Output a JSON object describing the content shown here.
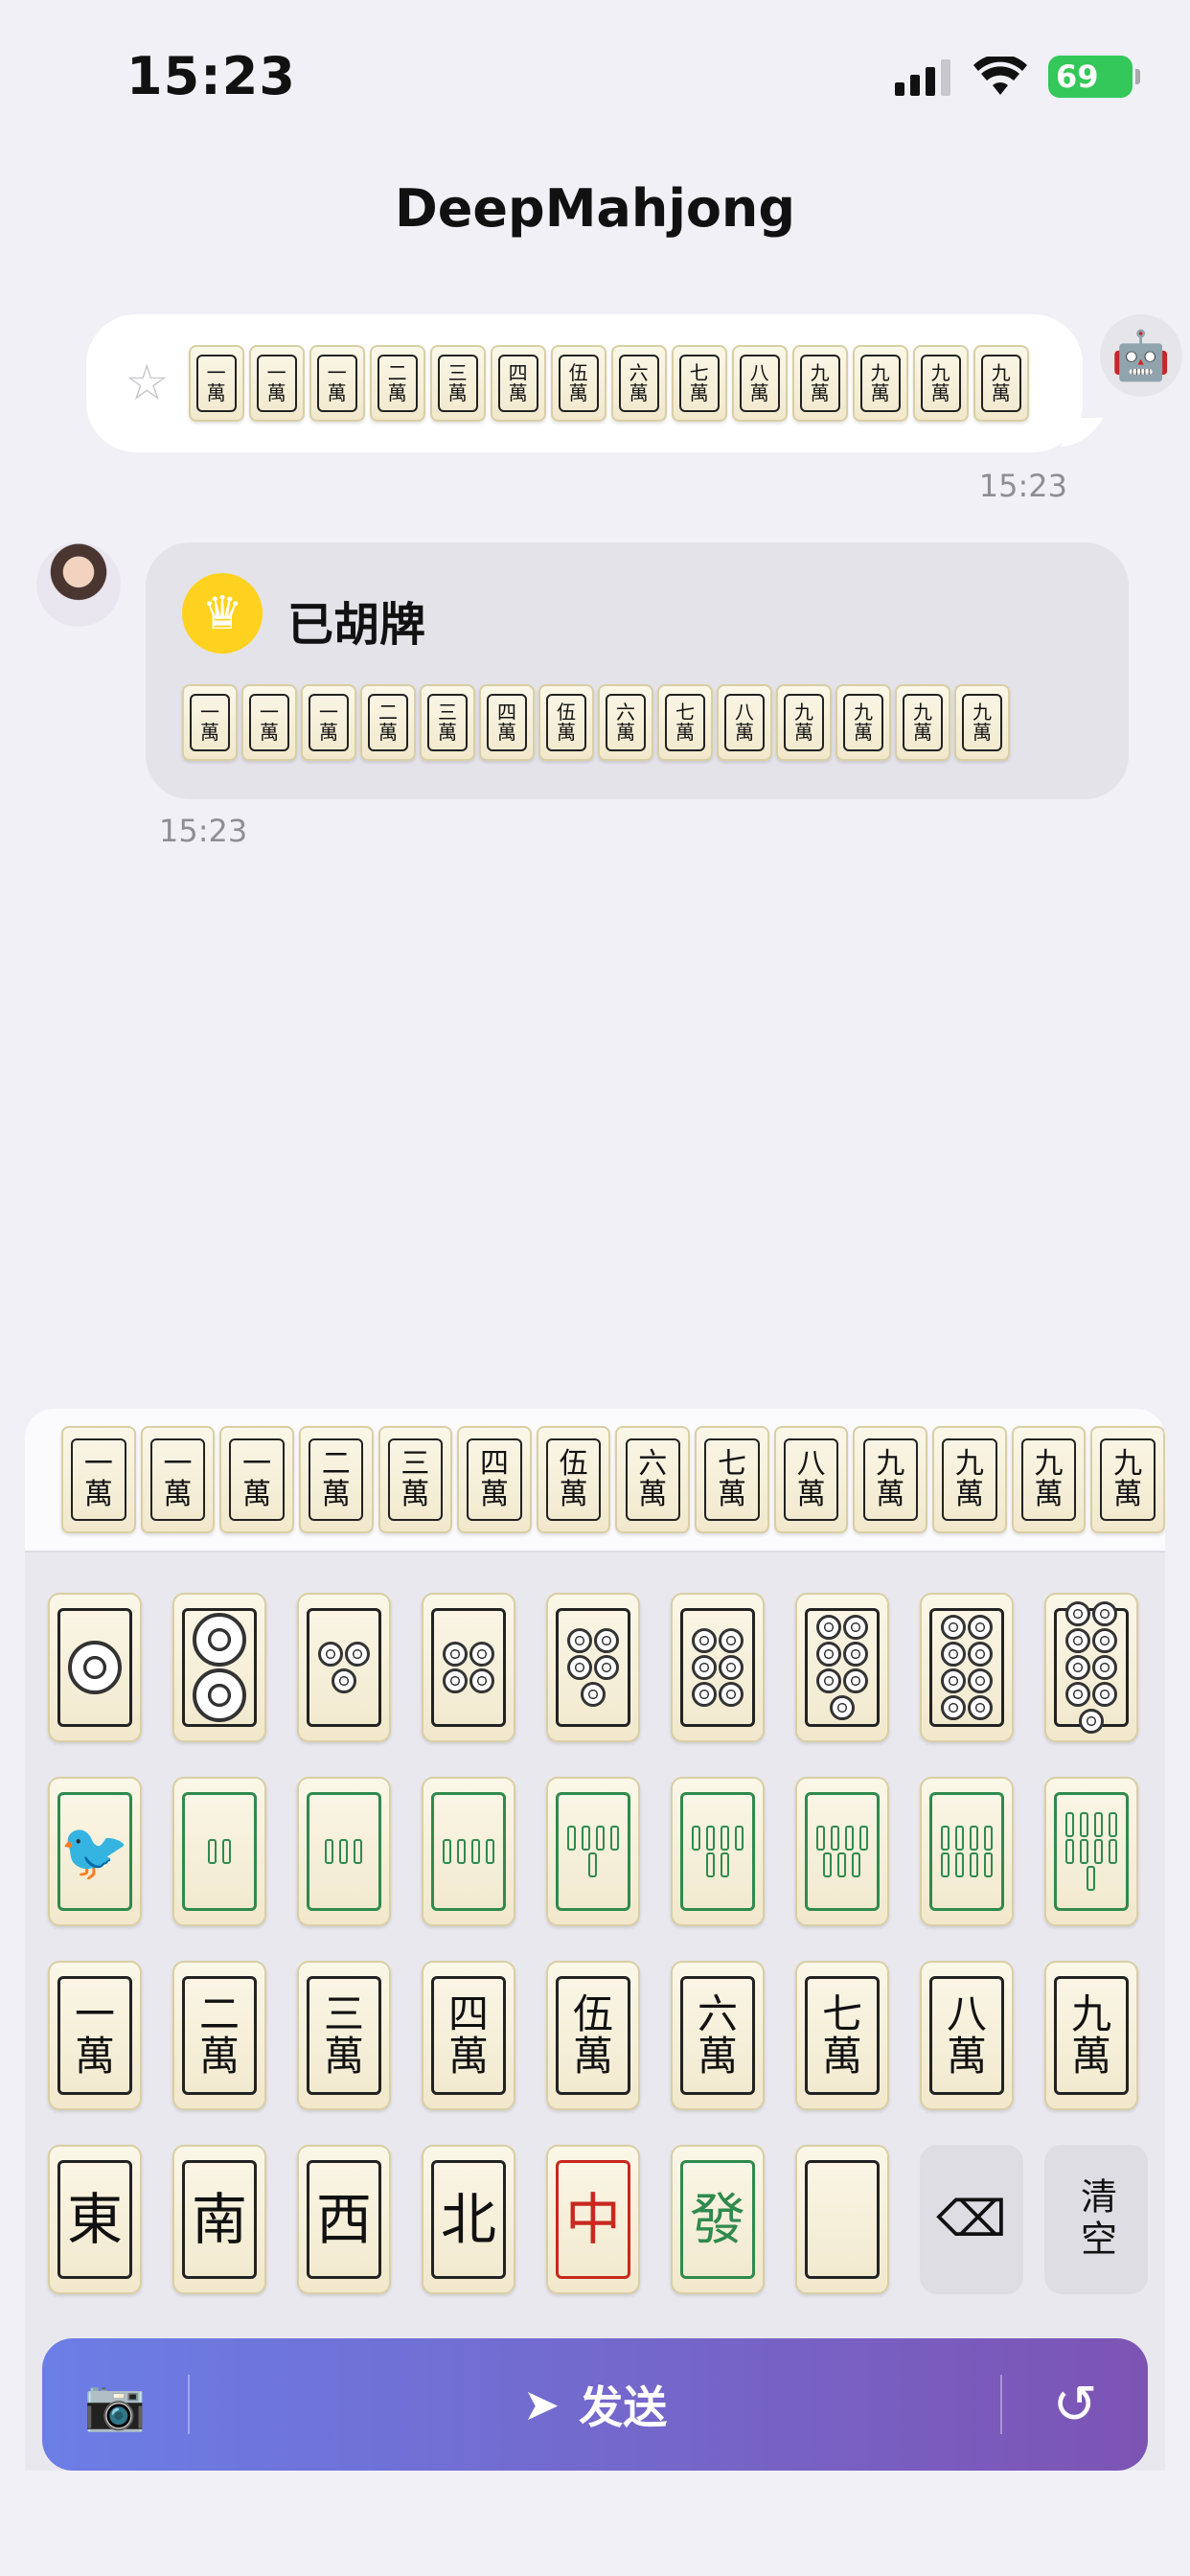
{
  "status_bar": {
    "time": "15:23",
    "battery": "69"
  },
  "title": "DeepMahjong",
  "outgoing_message": {
    "tiles": [
      [
        "一",
        "萬"
      ],
      [
        "一",
        "萬"
      ],
      [
        "一",
        "萬"
      ],
      [
        "二",
        "萬"
      ],
      [
        "三",
        "萬"
      ],
      [
        "四",
        "萬"
      ],
      [
        "伍",
        "萬"
      ],
      [
        "六",
        "萬"
      ],
      [
        "七",
        "萬"
      ],
      [
        "八",
        "萬"
      ],
      [
        "九",
        "萬"
      ],
      [
        "九",
        "萬"
      ],
      [
        "九",
        "萬"
      ],
      [
        "九",
        "萬"
      ]
    ],
    "timestamp": "15:23"
  },
  "incoming_message": {
    "label": "已胡牌",
    "tiles": [
      [
        "一",
        "萬"
      ],
      [
        "一",
        "萬"
      ],
      [
        "一",
        "萬"
      ],
      [
        "二",
        "萬"
      ],
      [
        "三",
        "萬"
      ],
      [
        "四",
        "萬"
      ],
      [
        "伍",
        "萬"
      ],
      [
        "六",
        "萬"
      ],
      [
        "七",
        "萬"
      ],
      [
        "八",
        "萬"
      ],
      [
        "九",
        "萬"
      ],
      [
        "九",
        "萬"
      ],
      [
        "九",
        "萬"
      ],
      [
        "九",
        "萬"
      ]
    ],
    "timestamp": "15:23"
  },
  "hand_row": [
    [
      "一",
      "萬"
    ],
    [
      "一",
      "萬"
    ],
    [
      "一",
      "萬"
    ],
    [
      "二",
      "萬"
    ],
    [
      "三",
      "萬"
    ],
    [
      "四",
      "萬"
    ],
    [
      "伍",
      "萬"
    ],
    [
      "六",
      "萬"
    ],
    [
      "七",
      "萬"
    ],
    [
      "八",
      "萬"
    ],
    [
      "九",
      "萬"
    ],
    [
      "九",
      "萬"
    ],
    [
      "九",
      "萬"
    ],
    [
      "九",
      "萬"
    ]
  ],
  "keyboard": {
    "dots": [
      1,
      2,
      3,
      4,
      5,
      6,
      7,
      8,
      9
    ],
    "bamboo": [
      1,
      2,
      3,
      4,
      5,
      6,
      7,
      8,
      9
    ],
    "characters": [
      [
        "一",
        "萬"
      ],
      [
        "二",
        "萬"
      ],
      [
        "三",
        "萬"
      ],
      [
        "四",
        "萬"
      ],
      [
        "伍",
        "萬"
      ],
      [
        "六",
        "萬"
      ],
      [
        "七",
        "萬"
      ],
      [
        "八",
        "萬"
      ],
      [
        "九",
        "萬"
      ]
    ],
    "honors": [
      "東",
      "南",
      "西",
      "北",
      "中",
      "發",
      ""
    ],
    "delete_icon": "backspace-icon",
    "clear_label": "清空"
  },
  "send_bar": {
    "send_label": "发送"
  }
}
